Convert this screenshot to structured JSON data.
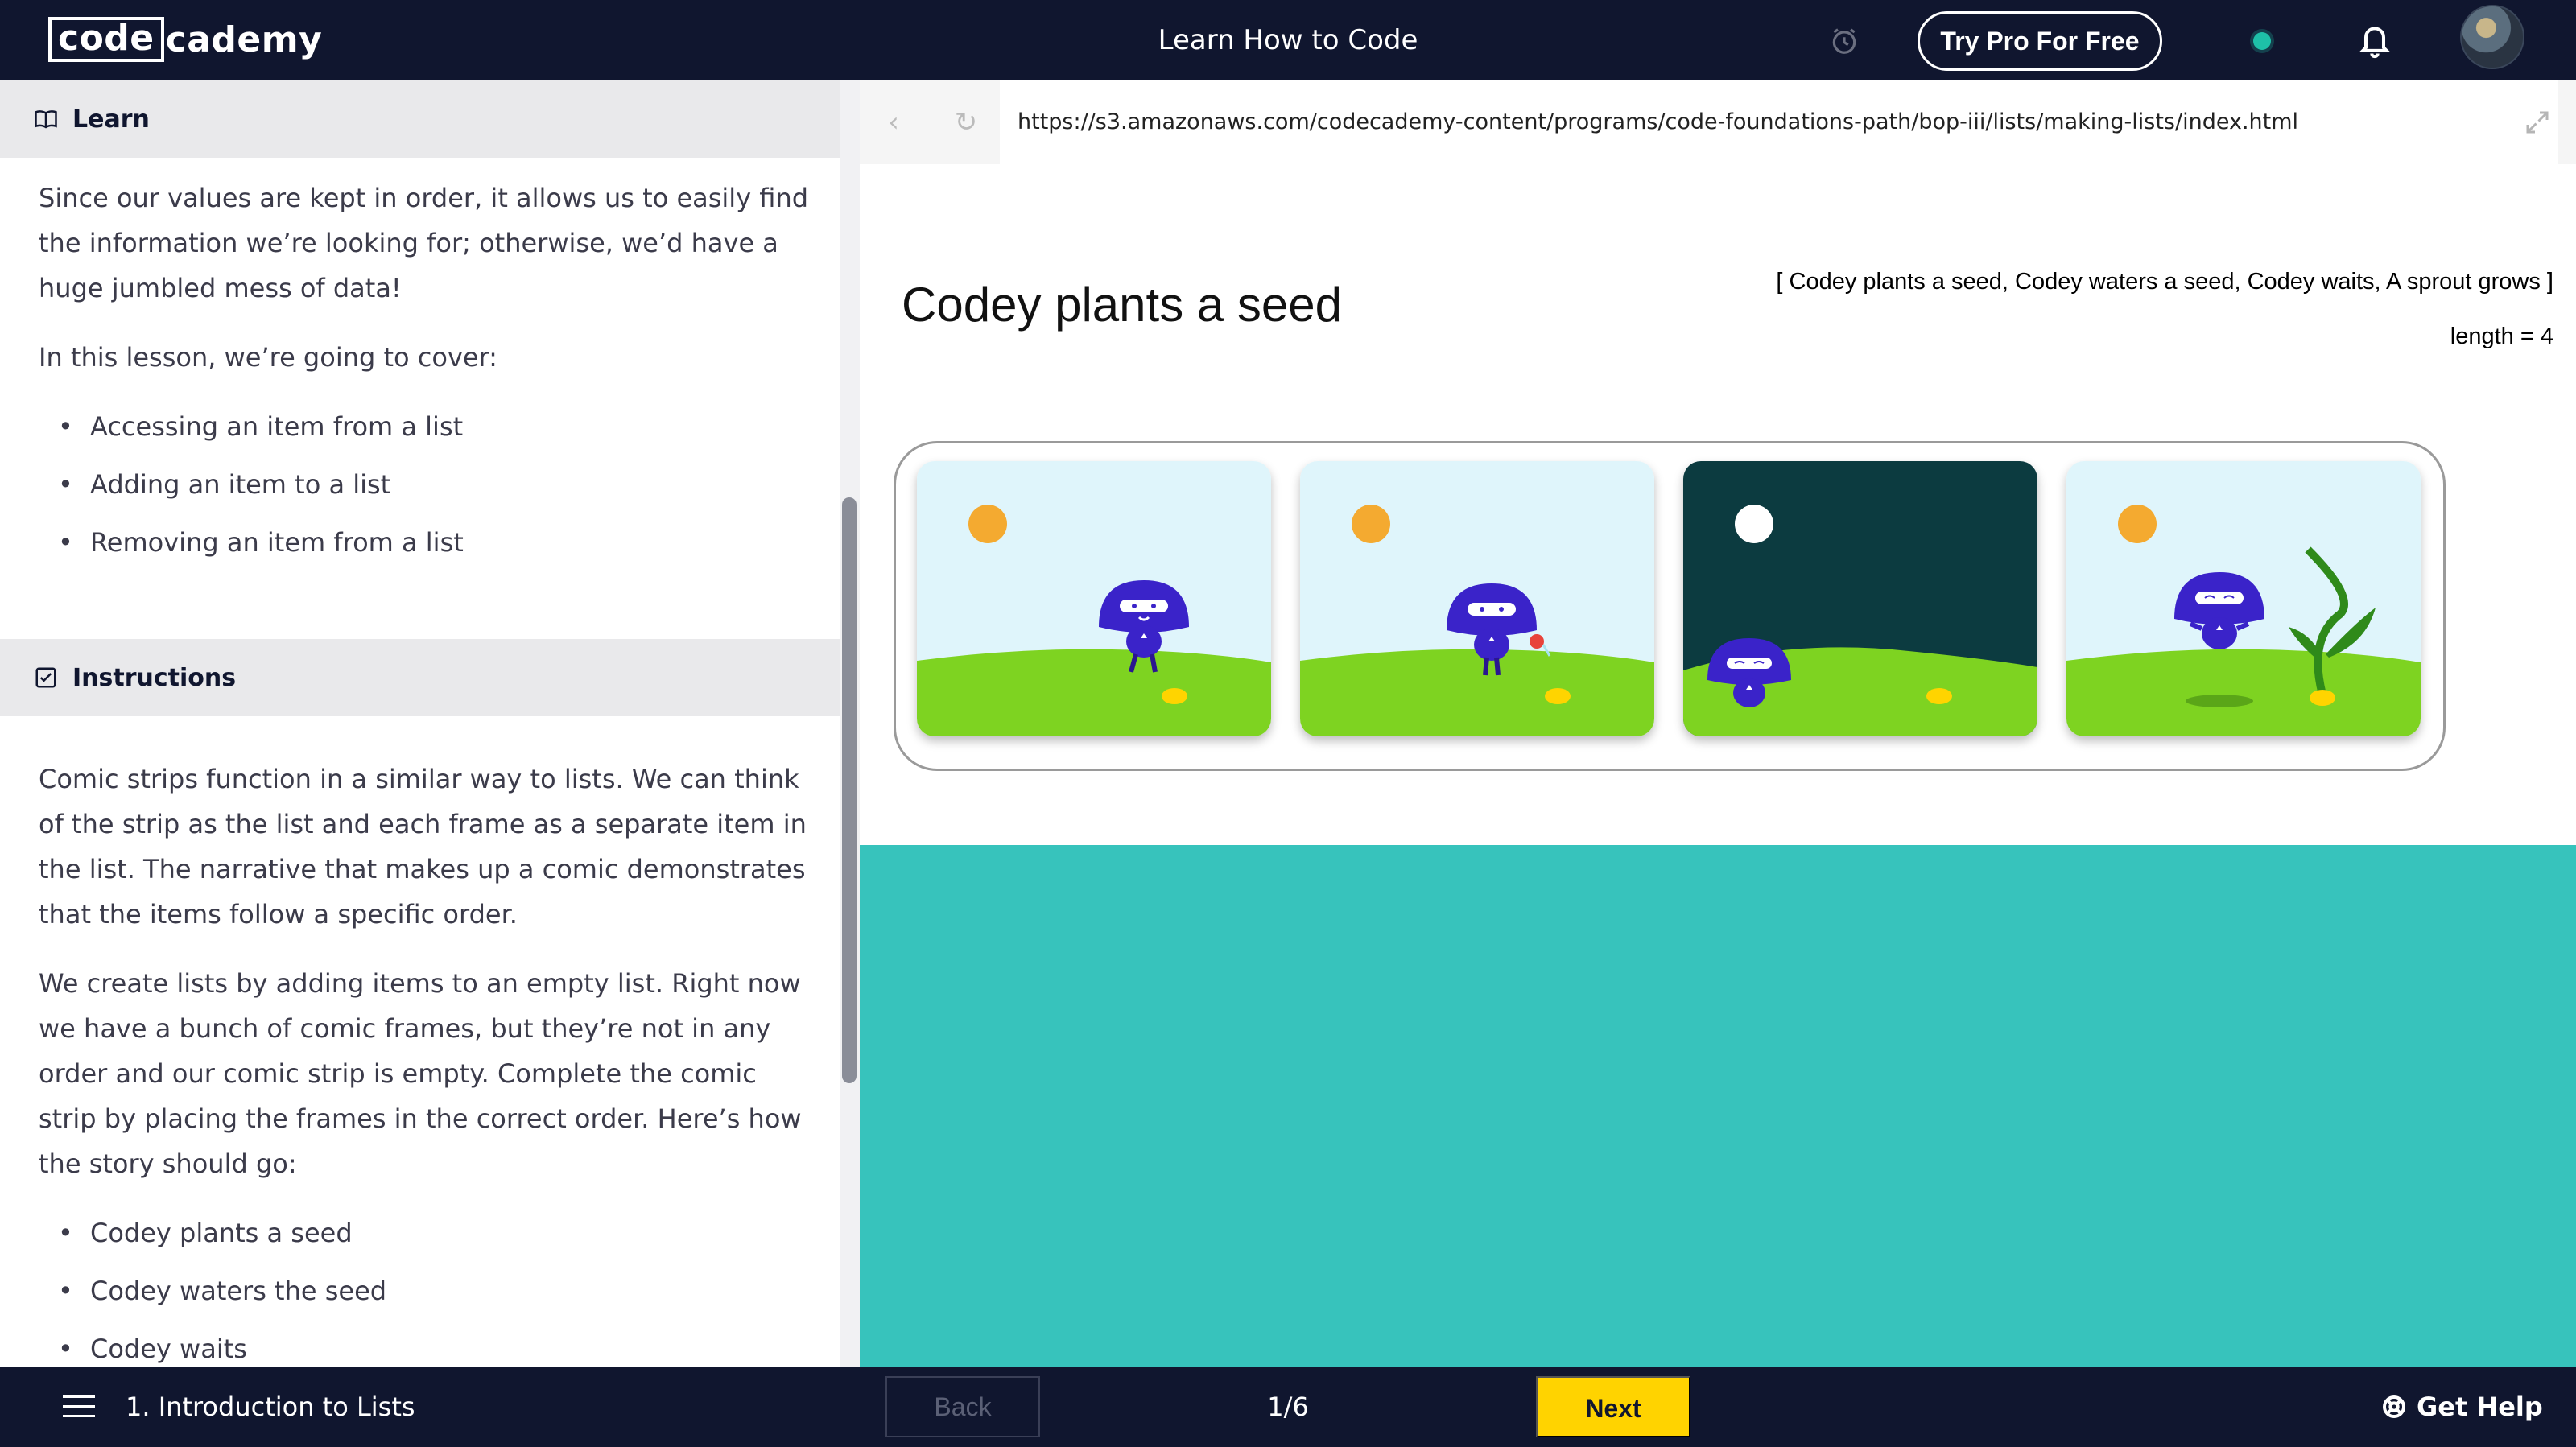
{
  "topbar": {
    "logo_box": "code",
    "logo_rest": "cademy",
    "title": "Learn How to Code",
    "pro_button": "Try Pro For Free"
  },
  "learn": {
    "heading": "Learn",
    "intro": "Since our values are kept in order, it allows us to easily find the information we’re looking for; otherwise, we’d have a huge jumbled mess of data!",
    "cover_intro": "In this lesson, we’re going to cover:",
    "topics": [
      "Accessing an item from a list",
      "Adding an item to a list",
      "Removing an item from a list"
    ]
  },
  "instructions": {
    "heading": "Instructions",
    "para1": "Comic strips function in a similar way to lists. We can think of the strip as the list and each frame as a separate item in the list. The narrative that makes up a comic demonstrates that the items follow a specific order.",
    "para2": "We create lists by adding items to an empty list. Right now we have a bunch of comic frames, but they’re not in any order and our comic strip is empty. Complete the comic strip by placing the frames in the correct order. Here’s how the story should go:",
    "steps": [
      "Codey plants a seed",
      "Codey waters the seed",
      "Codey waits"
    ]
  },
  "browser": {
    "back_glyph": "‹",
    "reload_glyph": "↻",
    "url": "https://s3.amazonaws.com/codecademy-content/programs/code-foundations-path/bop-iii/lists/making-lists/index.html"
  },
  "comic": {
    "current_title": "Codey plants a seed",
    "list_readout": "[ Codey plants a seed, Codey waters a seed, Codey waits, A sprout grows ]",
    "length_readout": "length = 4",
    "frames": [
      {
        "scene": "plants-seed",
        "sky": "#dff5fb",
        "sun": "#f6a21a"
      },
      {
        "scene": "waters-seed",
        "sky": "#dff5fb",
        "sun": "#f6a21a"
      },
      {
        "scene": "waits-night",
        "sky": "#0c3b40",
        "sun": "#ffffff"
      },
      {
        "scene": "sprout-grows",
        "sky": "#dff5fb",
        "sun": "#f6a21a"
      }
    ]
  },
  "bottombar": {
    "lesson": "1. Introduction to Lists",
    "back": "Back",
    "page": "1/6",
    "next": "Next",
    "help": "Get Help"
  },
  "colors": {
    "nav_bg": "#10162f",
    "teal": "#37c3bc",
    "next_yellow": "#ffd300",
    "grass": "#7ed321",
    "codey_purple": "#3a23c9"
  }
}
